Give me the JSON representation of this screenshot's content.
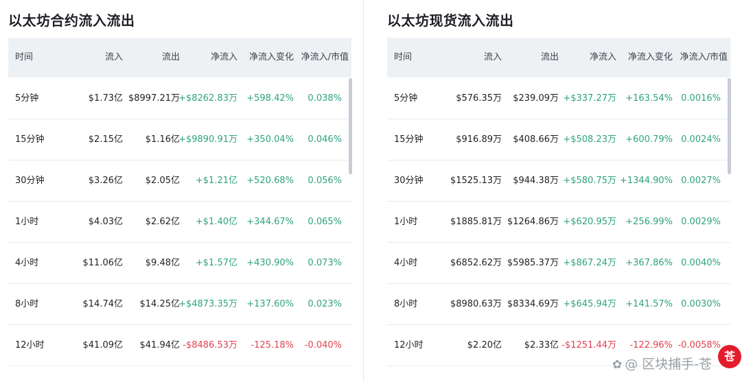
{
  "panels": [
    {
      "title": "以太坊合约流入流出",
      "headers": [
        "时间",
        "流入",
        "流出",
        "净流入",
        "净流入变化",
        "净流入/市值"
      ],
      "rows": [
        {
          "time": "5分钟",
          "inflow": "$1.73亿",
          "outflow": "$8997.21万",
          "net": "+$8262.83万",
          "change": "+598.42%",
          "ratio": "0.038%",
          "sign": "pos"
        },
        {
          "time": "15分钟",
          "inflow": "$2.15亿",
          "outflow": "$1.16亿",
          "net": "+$9890.91万",
          "change": "+350.04%",
          "ratio": "0.046%",
          "sign": "pos"
        },
        {
          "time": "30分钟",
          "inflow": "$3.26亿",
          "outflow": "$2.05亿",
          "net": "+$1.21亿",
          "change": "+520.68%",
          "ratio": "0.056%",
          "sign": "pos"
        },
        {
          "time": "1小时",
          "inflow": "$4.03亿",
          "outflow": "$2.62亿",
          "net": "+$1.40亿",
          "change": "+344.67%",
          "ratio": "0.065%",
          "sign": "pos"
        },
        {
          "time": "4小时",
          "inflow": "$11.06亿",
          "outflow": "$9.48亿",
          "net": "+$1.57亿",
          "change": "+430.90%",
          "ratio": "0.073%",
          "sign": "pos"
        },
        {
          "time": "8小时",
          "inflow": "$14.74亿",
          "outflow": "$14.25亿",
          "net": "+$4873.35万",
          "change": "+137.60%",
          "ratio": "0.023%",
          "sign": "pos"
        },
        {
          "time": "12小时",
          "inflow": "$41.09亿",
          "outflow": "$41.94亿",
          "net": "-$8486.53万",
          "change": "-125.18%",
          "ratio": "-0.040%",
          "sign": "neg"
        }
      ]
    },
    {
      "title": "以太坊现货流入流出",
      "headers": [
        "时间",
        "流入",
        "流出",
        "净流入",
        "净流入变化",
        "净流入/市值"
      ],
      "rows": [
        {
          "time": "5分钟",
          "inflow": "$576.35万",
          "outflow": "$239.09万",
          "net": "+$337.27万",
          "change": "+163.54%",
          "ratio": "0.0016%",
          "sign": "pos"
        },
        {
          "time": "15分钟",
          "inflow": "$916.89万",
          "outflow": "$408.66万",
          "net": "+$508.23万",
          "change": "+600.79%",
          "ratio": "0.0024%",
          "sign": "pos"
        },
        {
          "time": "30分钟",
          "inflow": "$1525.13万",
          "outflow": "$944.38万",
          "net": "+$580.75万",
          "change": "+1344.90%",
          "ratio": "0.0027%",
          "sign": "pos"
        },
        {
          "time": "1小时",
          "inflow": "$1885.81万",
          "outflow": "$1264.86万",
          "net": "+$620.95万",
          "change": "+256.99%",
          "ratio": "0.0029%",
          "sign": "pos"
        },
        {
          "time": "4小时",
          "inflow": "$6852.62万",
          "outflow": "$5985.37万",
          "net": "+$867.24万",
          "change": "+367.86%",
          "ratio": "0.0040%",
          "sign": "pos"
        },
        {
          "time": "8小时",
          "inflow": "$8980.63万",
          "outflow": "$8334.69万",
          "net": "+$645.94万",
          "change": "+141.57%",
          "ratio": "0.0030%",
          "sign": "pos"
        },
        {
          "time": "12小时",
          "inflow": "$2.20亿",
          "outflow": "$2.33亿",
          "net": "-$1251.44万",
          "change": "-122.96%",
          "ratio": "-0.0058%",
          "sign": "neg"
        }
      ]
    }
  ],
  "watermark": {
    "icon": "wechat-channel-icon",
    "text": "@ 区块捕手-苍"
  },
  "badge": {
    "text": "苍"
  },
  "colors": {
    "positive": "#2ea27f",
    "negative": "#e0414f",
    "header_bg": "#eef1f4"
  }
}
